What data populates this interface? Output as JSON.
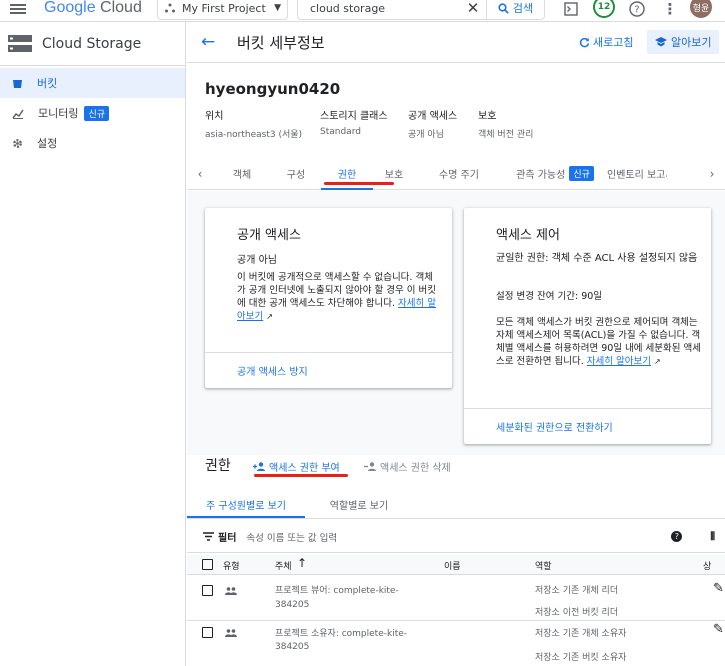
{
  "topbar": {
    "logo_google": "Google",
    "logo_cloud": "Cloud",
    "project": "My First Project",
    "search_value": "cloud storage",
    "search_button": "검색",
    "notifications": "12",
    "avatar": "형윤"
  },
  "sidebar": {
    "title": "Cloud Storage",
    "items": [
      {
        "label": "버킷"
      },
      {
        "label": "모니터링",
        "badge": "신규"
      },
      {
        "label": "설정"
      }
    ]
  },
  "header": {
    "title": "버킷 세부정보",
    "refresh": "새로고침",
    "learn": "알아보기"
  },
  "bucket": {
    "name": "hyeongyun0420",
    "props": [
      {
        "k": "위치",
        "v": "asia-northeast3 (서울)"
      },
      {
        "k": "스토리지 클래스",
        "v": "Standard"
      },
      {
        "k": "공개 액세스",
        "v": "공개 아님"
      },
      {
        "k": "보호",
        "v": "객체 버전 관리"
      }
    ]
  },
  "tabs": [
    "객체",
    "구성",
    "권한",
    "보호",
    "수명 주기",
    "관측 가능성",
    "인벤토리 보고서"
  ],
  "tab_badge": "신규",
  "public_card": {
    "title": "공개 액세스",
    "status": "공개 아님",
    "desc": "이 버킷에 공개적으로 액세스할 수 없습니다. 객체가 공개 인터넷에 노출되지 않아야 할 경우 이 버킷에 대한 공개 액세스도 차단해야 합니다.",
    "link": "자세히 알아보기",
    "action": "공개 액세스 방지"
  },
  "acl_card": {
    "title": "액세스 제어",
    "uniform": "균일한 권한: 객체 수준 ACL 사용 설정되지 않음",
    "changed": "설정 변경 잔여 기간: 90일",
    "desc": "모든 객체 액세스가 버킷 권한으로 제어되며 객체는 자체 액세스제어 목록(ACL)을 가질 수 없습니다. 객체별 액세스를 허용하려면 90일 내에 세분화된 액세스로 전환하면 됩니다.",
    "link": "자세히 알아보기",
    "action": "세분화된 권한으로 전환하기"
  },
  "permissions": {
    "title": "권한",
    "grant": "액세스 권한 부여",
    "remove": "액세스 권한 삭제",
    "view_tabs": [
      "주 구성원별로 보기",
      "역할별로 보기"
    ],
    "filter_label": "필터",
    "filter_placeholder": "속성 이름 또는 값 입력",
    "columns": [
      "유형",
      "주체",
      "이름",
      "역할",
      "상"
    ],
    "rows": [
      {
        "principal_1": "프로젝트 뷰어: complete-kite-",
        "principal_2": "384205",
        "role_1": "저장소 기존 개체 리더",
        "role_2": "저장소 이전 버킷 리더"
      },
      {
        "principal_1": "프로젝트 소유자: complete-kite-",
        "principal_2": "384205",
        "role_1": "저장소 기존 개체 소유자",
        "role_2": "저장소 기존 버킷 소유자"
      }
    ]
  },
  "colors": {
    "accent": "#1a73e8",
    "annotation_red": "#e8201a"
  }
}
